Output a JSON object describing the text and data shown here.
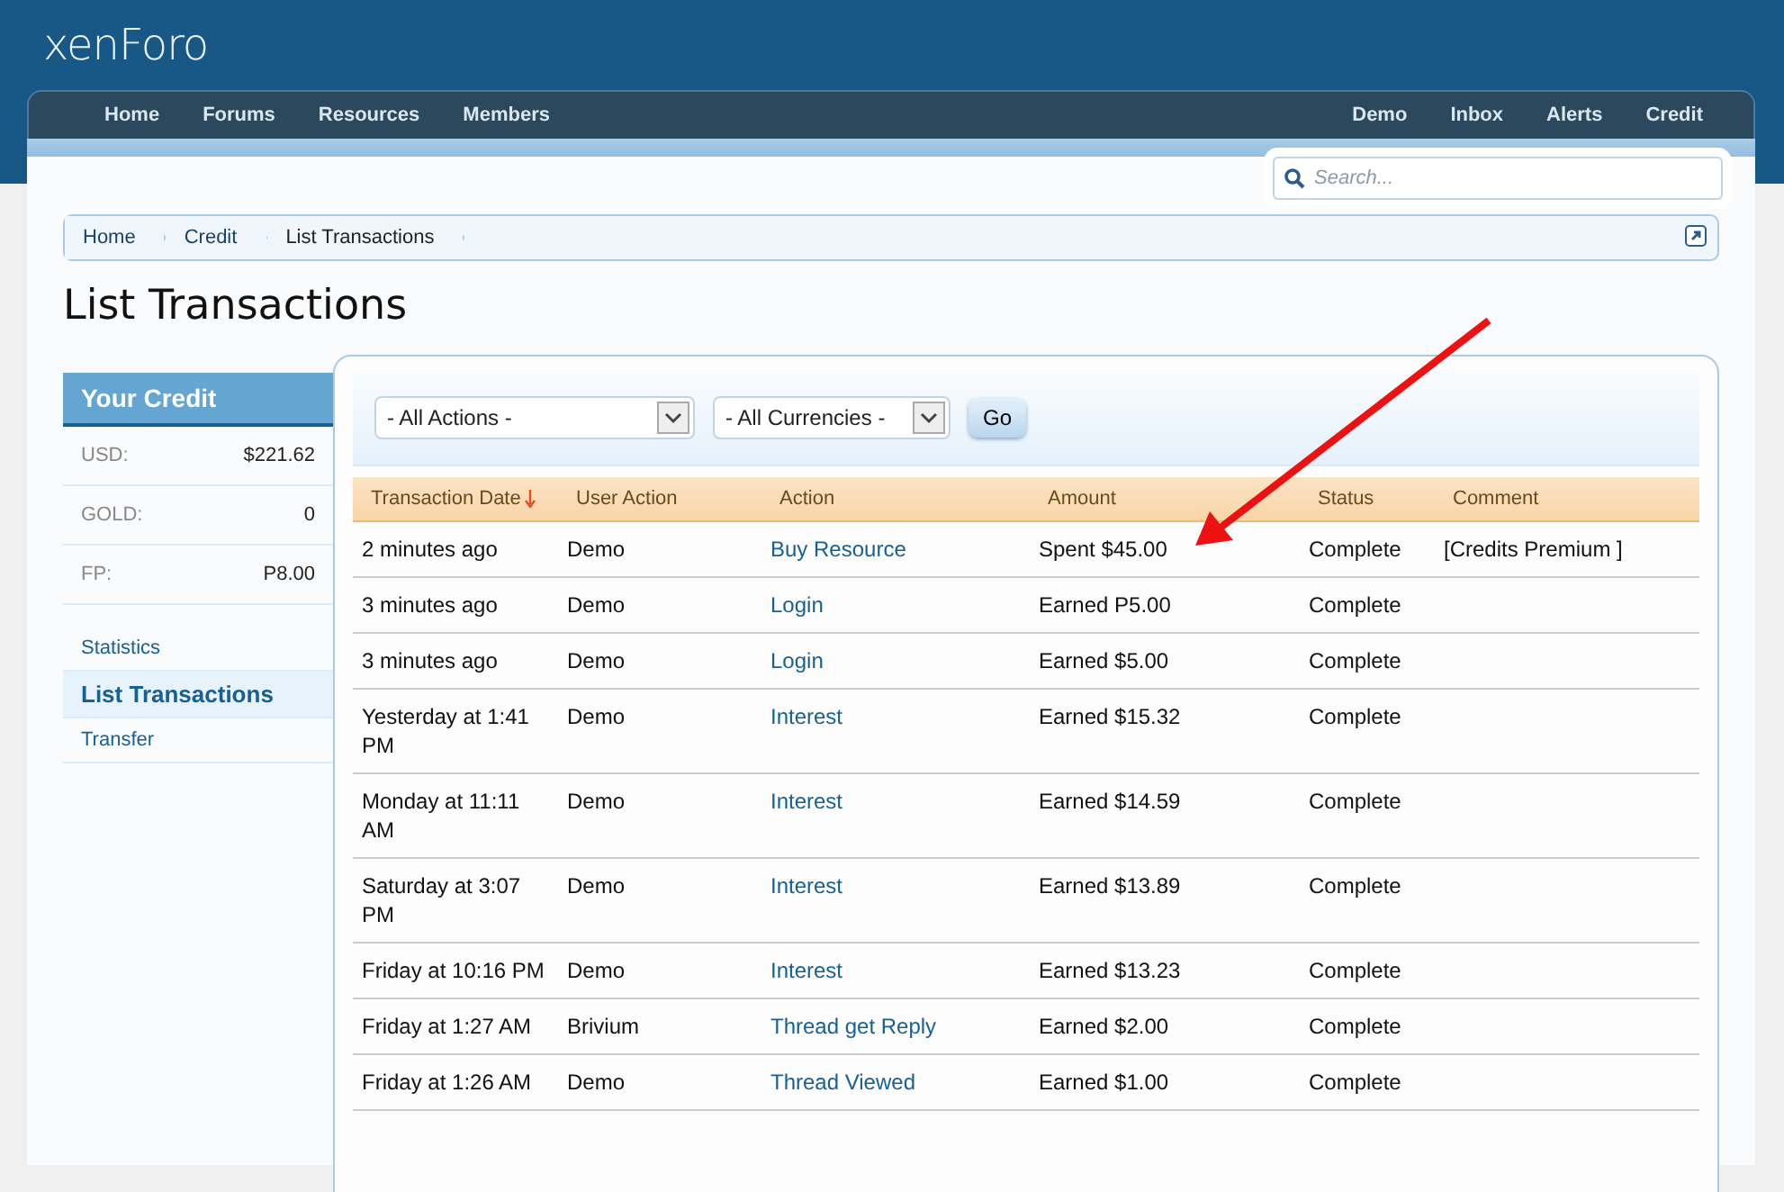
{
  "logo": "xenForo",
  "nav": {
    "left": [
      {
        "label": "Home"
      },
      {
        "label": "Forums"
      },
      {
        "label": "Resources"
      },
      {
        "label": "Members"
      }
    ],
    "right": [
      {
        "label": "Demo"
      },
      {
        "label": "Inbox"
      },
      {
        "label": "Alerts"
      },
      {
        "label": "Credit"
      }
    ]
  },
  "search": {
    "placeholder": "Search..."
  },
  "breadcrumb": [
    {
      "label": "Home"
    },
    {
      "label": "Credit"
    },
    {
      "label": "List Transactions"
    }
  ],
  "title": "List Transactions",
  "sidebar": {
    "heading": "Your Credit",
    "balances": [
      {
        "label": "USD:",
        "value": "$221.62"
      },
      {
        "label": "GOLD:",
        "value": "0"
      },
      {
        "label": "FP:",
        "value": "P8.00"
      }
    ],
    "links": [
      {
        "label": "Statistics",
        "selected": false
      },
      {
        "label": "List Transactions",
        "selected": true
      },
      {
        "label": "Transfer",
        "selected": false
      }
    ]
  },
  "filters": {
    "actions": "- All Actions -",
    "currencies": "- All Currencies -",
    "button": "Go"
  },
  "table": {
    "columns": [
      {
        "label": "Transaction Date",
        "sorted": true
      },
      {
        "label": "User Action",
        "sorted": false
      },
      {
        "label": "Action",
        "sorted": false
      },
      {
        "label": "Amount",
        "sorted": false
      },
      {
        "label": "Status",
        "sorted": false
      },
      {
        "label": "Comment",
        "sorted": false
      }
    ],
    "rows": [
      {
        "date": "2 minutes ago",
        "user": "Demo",
        "action": "Buy Resource",
        "amount": "Spent $45.00",
        "status": "Complete",
        "comment": "[Credits Premium ]"
      },
      {
        "date": "3 minutes ago",
        "user": "Demo",
        "action": "Login",
        "amount": "Earned P5.00",
        "status": "Complete"
      },
      {
        "date": "3 minutes ago",
        "user": "Demo",
        "action": "Login",
        "amount": "Earned $5.00",
        "status": "Complete"
      },
      {
        "date": "Yesterday at 1:41 PM",
        "user": "Demo",
        "action": "Interest",
        "amount": "Earned $15.32",
        "status": "Complete"
      },
      {
        "date": "Monday at 11:11 AM",
        "user": "Demo",
        "action": "Interest",
        "amount": "Earned $14.59",
        "status": "Complete"
      },
      {
        "date": "Saturday at 3:07 PM",
        "user": "Demo",
        "action": "Interest",
        "amount": "Earned $13.89",
        "status": "Complete"
      },
      {
        "date": "Friday at 10:16 PM",
        "user": "Demo",
        "action": "Interest",
        "amount": "Earned $13.23",
        "status": "Complete"
      },
      {
        "date": "Friday at 1:27 AM",
        "user": "Brivium",
        "action": "Thread get Reply",
        "amount": "Earned $2.00",
        "status": "Complete"
      },
      {
        "date": "Friday at 1:26 AM",
        "user": "Demo",
        "action": "Thread Viewed",
        "amount": "Earned $1.00",
        "status": "Complete"
      }
    ]
  }
}
